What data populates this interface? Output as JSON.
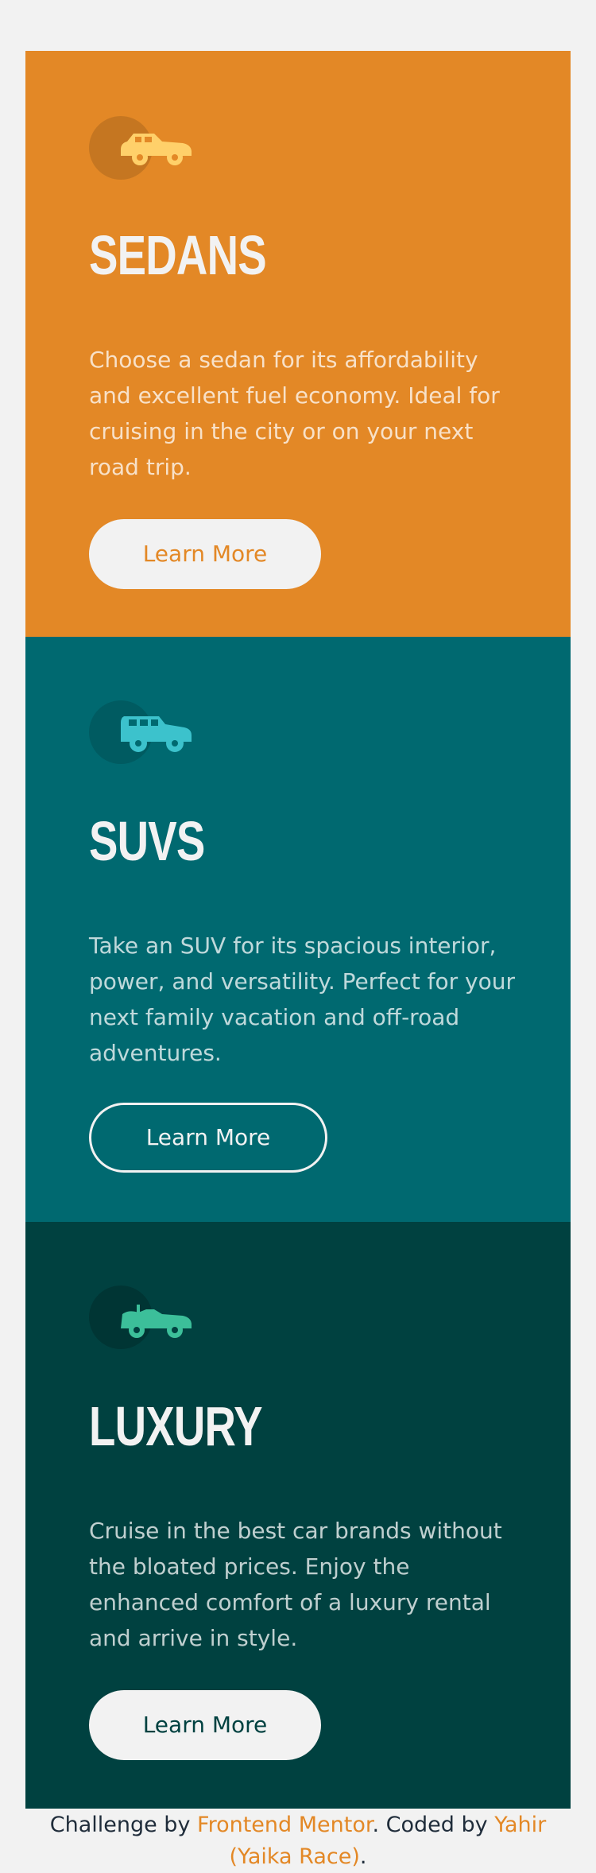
{
  "cards": [
    {
      "title": "SEDANS",
      "text": "Choose a sedan for its affordability and excellent fuel economy. Ideal for cruising in the city or on your next road trip.",
      "button": "Learn More",
      "color": "#e38826",
      "icon": "sedan-icon"
    },
    {
      "title": "SUVS",
      "text": "Take an SUV for its spacious interior, power, and versatility. Perfect for your next family vacation and off-road adventures.",
      "button": "Learn More",
      "color": "#006970",
      "icon": "suv-icon"
    },
    {
      "title": "LUXURY",
      "text": "Cruise in the best car brands without the bloated prices. Enjoy the enhanced comfort of a luxury rental and arrive in style.",
      "button": "Learn More",
      "color": "#004140",
      "icon": "luxury-car-icon"
    }
  ],
  "footer": {
    "prefix": "Challenge by ",
    "link1": "Frontend Mentor",
    "middle": ". Coded by ",
    "link2": "Yahir (Yaika Race)",
    "suffix": "."
  },
  "colors": {
    "background": "#f2f2f2",
    "sedans": "#e38826",
    "suvs": "#006970",
    "luxury": "#004140",
    "text_light": "#f2f2f2"
  }
}
